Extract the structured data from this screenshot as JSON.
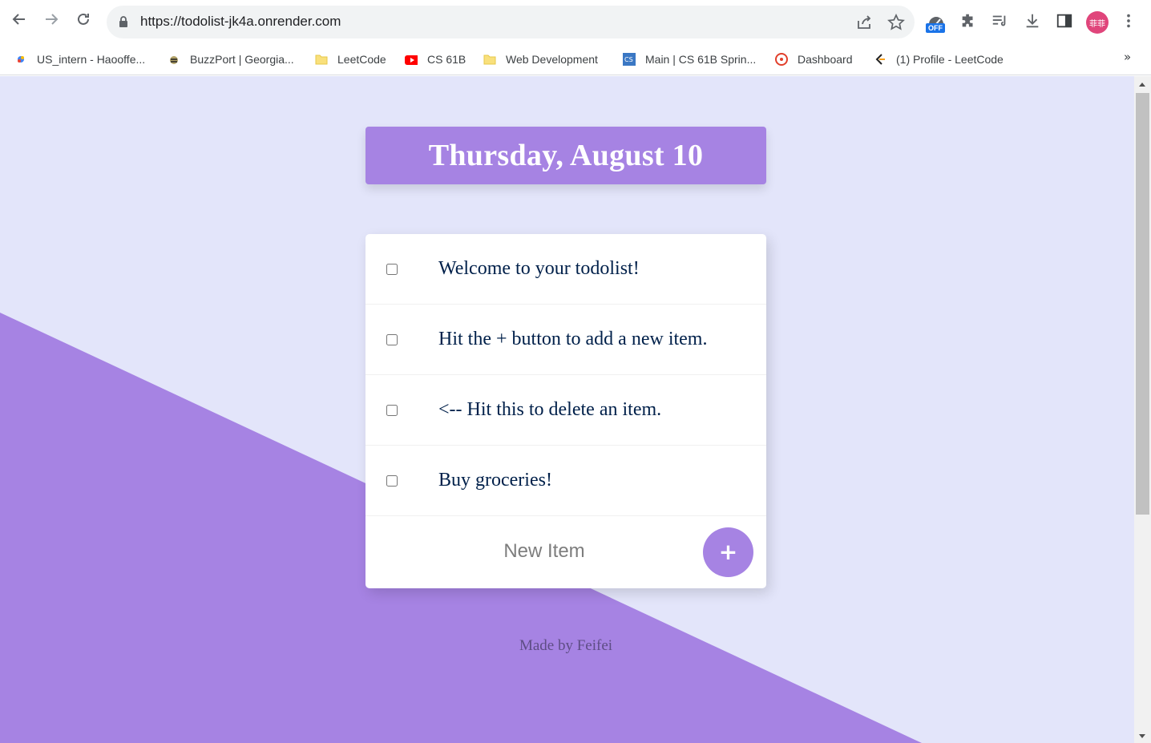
{
  "browser": {
    "url": "https://todolist-jk4a.onrender.com",
    "extension_badge": "OFF",
    "profile_label": "菲菲",
    "bookmarks": [
      {
        "label": "US_intern - Haooffe...",
        "icon": "sheets-icon"
      },
      {
        "label": "BuzzPort | Georgia...",
        "icon": "buzz-icon"
      },
      {
        "label": "LeetCode",
        "icon": "folder-icon"
      },
      {
        "label": "CS 61B",
        "icon": "youtube-icon"
      },
      {
        "label": "Web Development",
        "icon": "folder-icon"
      },
      {
        "label": "Main | CS 61B Sprin...",
        "icon": "cs-icon"
      },
      {
        "label": "Dashboard",
        "icon": "canvas-icon"
      },
      {
        "label": "(1) Profile - LeetCode",
        "icon": "leetcode-icon"
      }
    ],
    "bookmarks_more": "»"
  },
  "page": {
    "heading": "Thursday, August 10",
    "items": [
      {
        "text": "Welcome to your todolist!",
        "checked": false
      },
      {
        "text": "Hit the + button to add a new item.",
        "checked": false
      },
      {
        "text": "<-- Hit this to delete an item.",
        "checked": false
      },
      {
        "text": "Buy groceries!",
        "checked": false
      }
    ],
    "new_item_placeholder": "New Item",
    "add_button_label": "+",
    "footer": "Made by Feifei"
  },
  "colors": {
    "accent": "#a683e3",
    "background": "#e3e5fa",
    "text": "#00204a"
  }
}
